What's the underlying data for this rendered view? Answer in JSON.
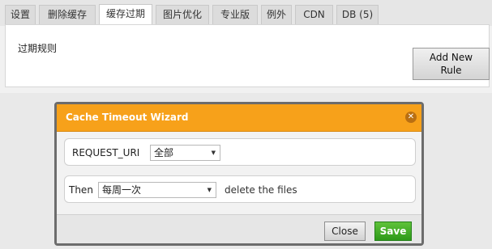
{
  "tabs": [
    {
      "label": "设置",
      "active": false
    },
    {
      "label": "删除缓存",
      "active": false
    },
    {
      "label": "缓存过期",
      "active": true
    },
    {
      "label": "图片优化",
      "active": false
    },
    {
      "label": "专业版",
      "active": false
    },
    {
      "label": "例外",
      "active": false
    },
    {
      "label": "CDN",
      "active": false
    },
    {
      "label": "DB (5)",
      "active": false
    }
  ],
  "panel": {
    "label": "过期规则",
    "add_new_line1": "Add New",
    "add_new_line2": "Rule"
  },
  "modal": {
    "title": "Cache Timeout Wizard",
    "close_icon": "close-icon",
    "row1": {
      "label": "REQUEST_URI",
      "select_value": "全部"
    },
    "row2": {
      "label": "Then",
      "select_value": "每周一次",
      "after_text": "delete the files"
    },
    "buttons": {
      "close": "Close",
      "save": "Save"
    }
  },
  "colors": {
    "header": "#f7a11a",
    "save": "#3aa820"
  }
}
